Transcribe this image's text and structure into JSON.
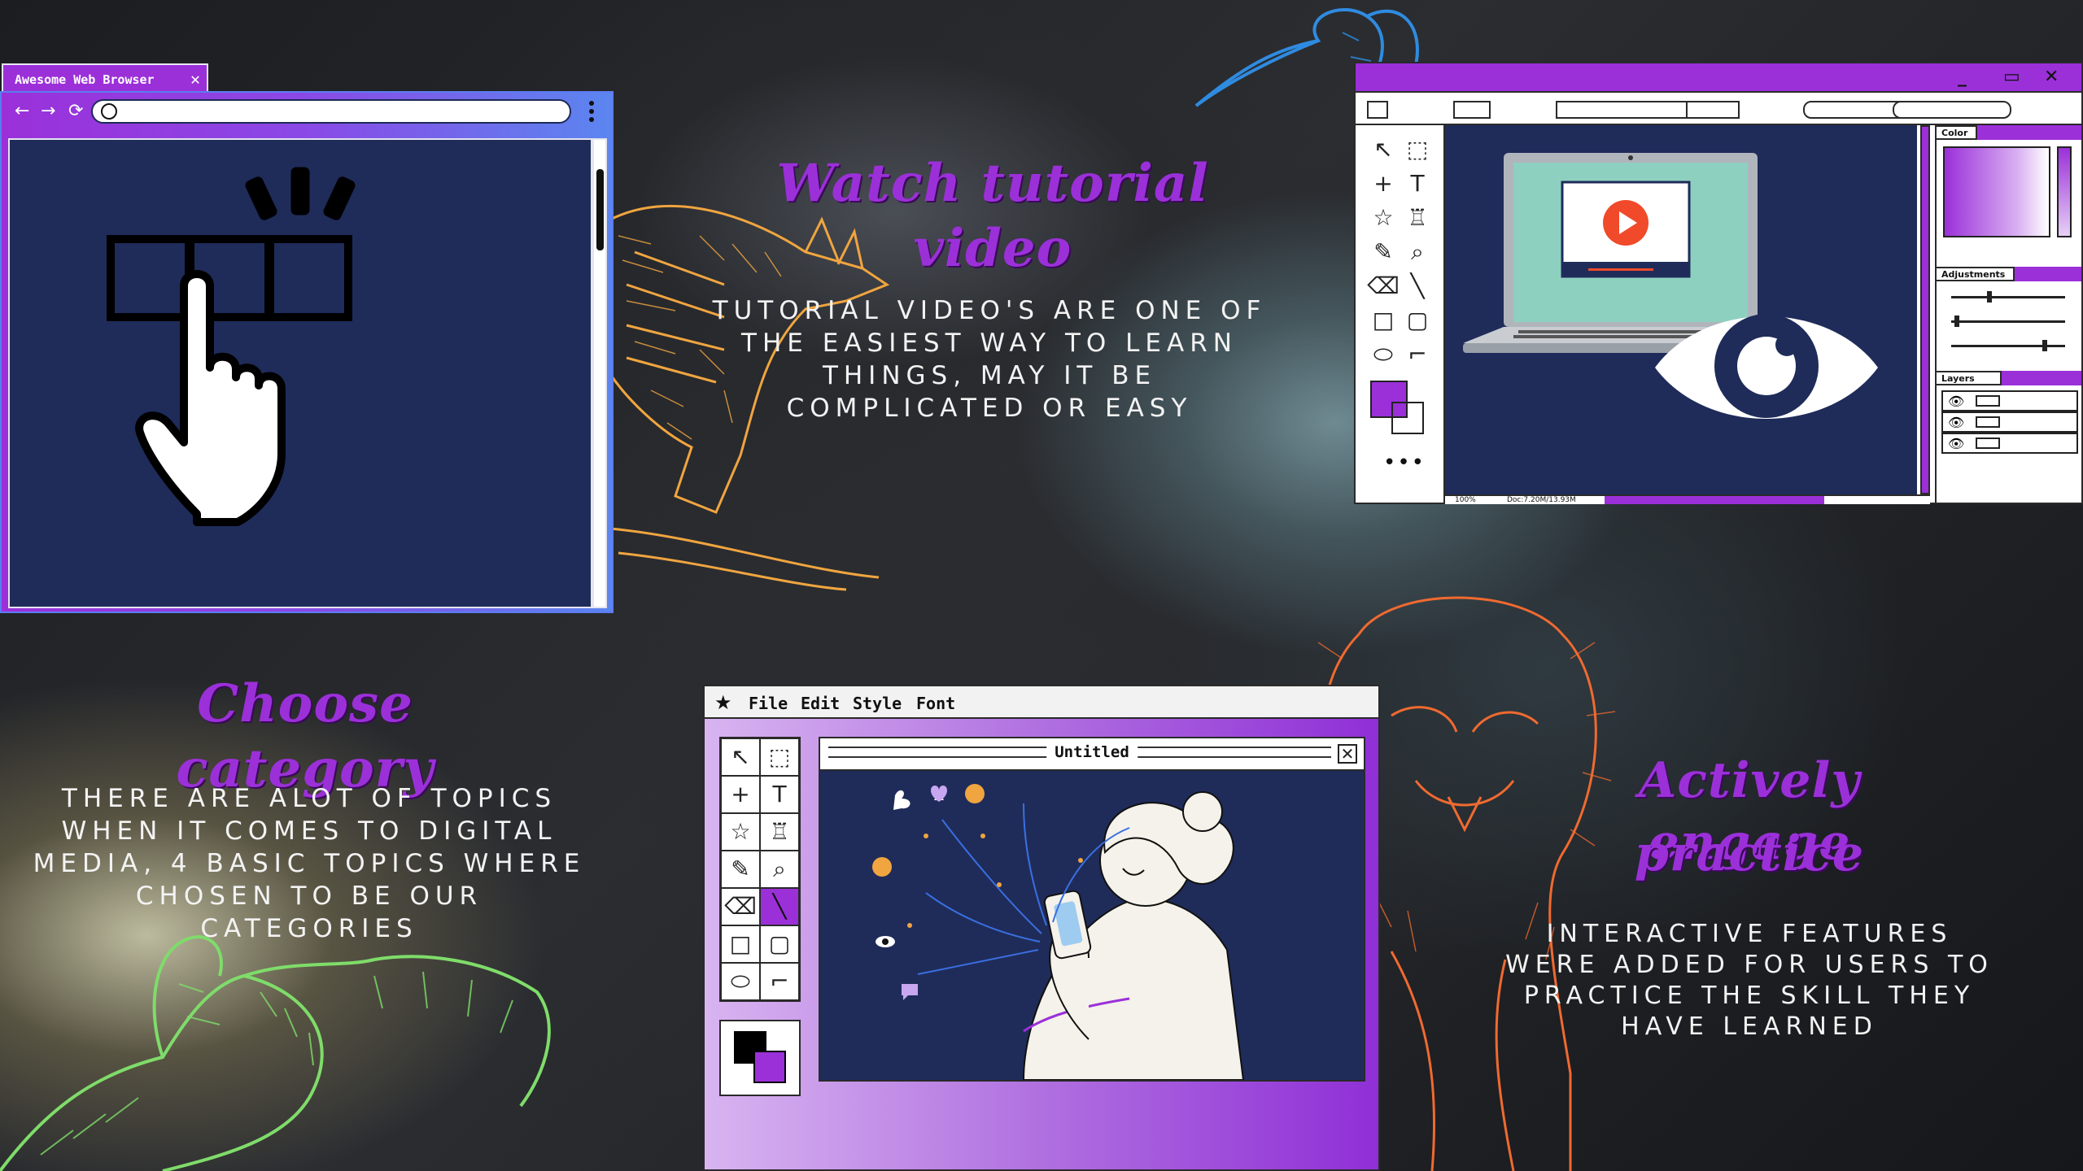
{
  "slide": {
    "sections": [
      {
        "id": "watch",
        "heading": "Watch tutorial video",
        "body": "TUTORIAL VIDEO'S ARE ONE OF THE EASIEST WAY TO LEARN THINGS, MAY IT BE COMPLICATED OR EASY"
      },
      {
        "id": "choose",
        "heading": "Choose category",
        "body": "THERE ARE ALOT OF TOPICS WHEN IT COMES TO DIGITAL MEDIA, 4 BASIC TOPICS WHERE CHOSEN TO BE OUR CATEGORIES"
      },
      {
        "id": "engage",
        "heading_line1": "Actively engage",
        "heading_line2": "practice",
        "body": "INTERACTIVE FEATURES WERE ADDED FOR USERS TO PRACTICE THE SKILL THEY HAVE LEARNED"
      }
    ]
  },
  "browser": {
    "tab_title": "Awesome Web Browser",
    "tab_close": "✕",
    "nav": {
      "back": "←",
      "forward": "→",
      "reload": "⟳"
    }
  },
  "editor": {
    "panels": {
      "color": "Color",
      "adjustments": "Adjustments",
      "layers": "Layers"
    },
    "status": {
      "zoom": "100%",
      "doc": "Doc:7.20M/13.93M"
    },
    "window_controls": {
      "minimize": "_",
      "maximize": "▭",
      "close": "✕"
    }
  },
  "paint": {
    "menu": [
      "File",
      "Edit",
      "Style",
      "Font"
    ],
    "document_title": "Untitled",
    "close": "✕"
  },
  "colors": {
    "accent_purple": "#9b30d9",
    "navy": "#1f2c5a",
    "raccoon": "#f0a540",
    "bird": "#2f8be0",
    "lion": "#f06a30",
    "lizard": "#7fdc6a"
  }
}
